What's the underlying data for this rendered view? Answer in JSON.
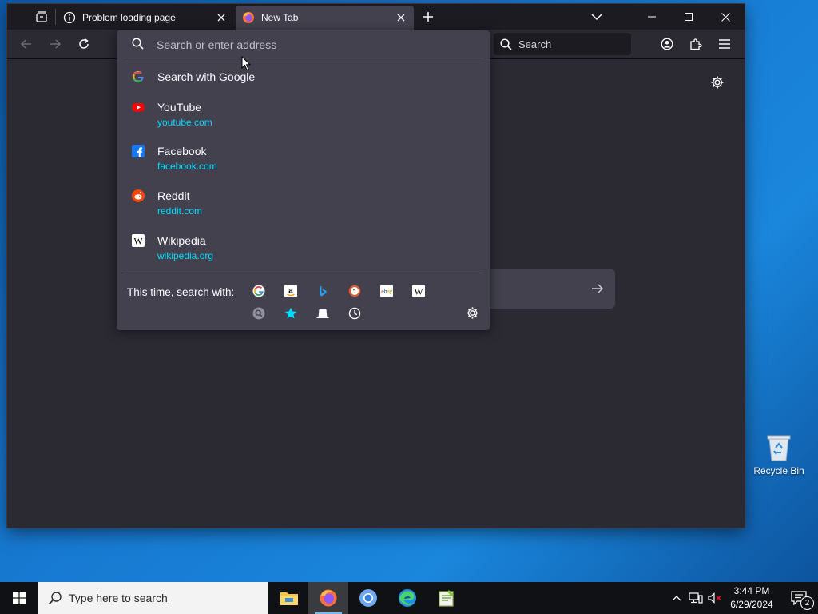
{
  "browser": {
    "tabs": [
      {
        "title": "Problem loading page",
        "icon": "info-icon",
        "active": false
      },
      {
        "title": "New Tab",
        "icon": "firefox-icon",
        "active": true
      }
    ],
    "searchbar_placeholder": "Search",
    "url_placeholder": "Search or enter address"
  },
  "url_dropdown": {
    "search_suggestion": "Search with Google",
    "results": [
      {
        "title": "YouTube",
        "url": "youtube.com",
        "icon": "youtube-icon"
      },
      {
        "title": "Facebook",
        "url": "facebook.com",
        "icon": "facebook-icon"
      },
      {
        "title": "Reddit",
        "url": "reddit.com",
        "icon": "reddit-icon"
      },
      {
        "title": "Wikipedia",
        "url": "wikipedia.org",
        "icon": "wikipedia-icon"
      }
    ],
    "oneoff_label": "This time, search with:",
    "engines_row1": [
      "google-icon",
      "amazon-icon",
      "bing-icon",
      "duckduckgo-icon",
      "ebay-icon",
      "wikipedia-icon"
    ],
    "engines_row2": [
      "search-tabs-icon",
      "bookmarks-star-icon",
      "tabs-icon",
      "history-icon"
    ]
  },
  "desktop": {
    "recycle_bin_label": "Recycle Bin"
  },
  "taskbar": {
    "search_placeholder": "Type here to search",
    "time": "3:44 PM",
    "date": "6/29/2024",
    "notification_count": "2"
  },
  "colors": {
    "accent_url": "#00ddff",
    "panel_bg": "#42414d",
    "window_bg": "#2b2a33"
  }
}
